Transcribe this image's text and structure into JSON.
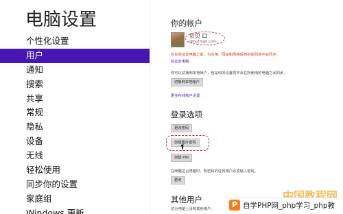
{
  "nav": {
    "title": "电脑设置",
    "items": [
      {
        "label": "个性化设置",
        "selected": false
      },
      {
        "label": "用户",
        "selected": true
      },
      {
        "label": "通知",
        "selected": false
      },
      {
        "label": "搜索",
        "selected": false
      },
      {
        "label": "共享",
        "selected": false
      },
      {
        "label": "常规",
        "selected": false
      },
      {
        "label": "隐私",
        "selected": false
      },
      {
        "label": "设备",
        "selected": false
      },
      {
        "label": "无线",
        "selected": false
      },
      {
        "label": "轻松使用",
        "selected": false
      },
      {
        "label": "同步你的设置",
        "selected": false
      },
      {
        "label": "家庭组",
        "selected": false
      },
      {
        "label": "Windows 更新",
        "selected": false
      }
    ]
  },
  "account": {
    "heading": "你的帐户",
    "name": "贝贝 口",
    "email": "@hotmail.com",
    "warning": "在你验证此电脑之前，为应用、网站和网络保存的密码将不会同步。",
    "verify_link": "验证此电脑",
    "local_note": "你可以切换到本地帐户，但是你的设置将不会在所使用的电脑之间同步。",
    "switch_button": "切换到本地帐户",
    "more_link": "更多在线帐户设置"
  },
  "signin": {
    "heading": "登录选项",
    "change_password_button": "更改密码",
    "picture_password_button": "创建图片密码",
    "pin_button": "创建 PIN",
    "wake_note": "在唤醒这台电脑时，有密码的任何用户必须输入密码。",
    "change_button": "更改"
  },
  "other_users": {
    "heading": "其他用户",
    "note": "这台电脑上没有其他用户。"
  },
  "watermark": {
    "brand": "中国教程网",
    "strip_text": "自学PHP网_php学习_php教"
  },
  "colors": {
    "accent": "#4617b4",
    "warning": "#d33b1f",
    "annotation": "#d6261c"
  }
}
